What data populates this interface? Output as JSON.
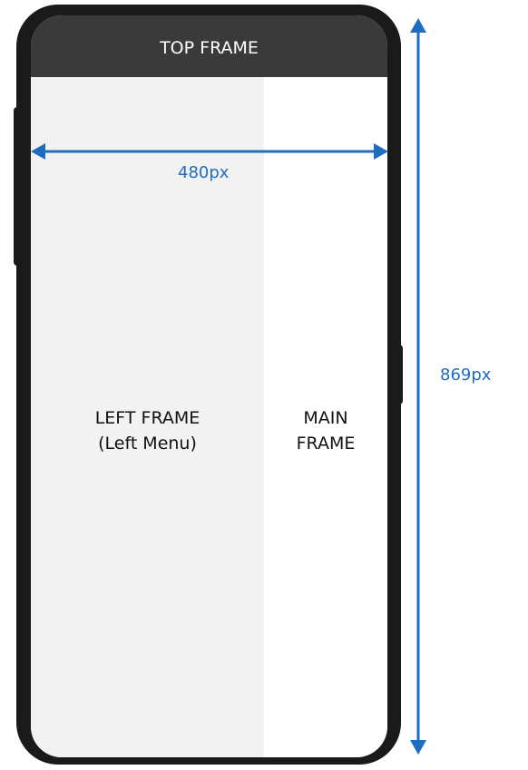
{
  "top_frame": {
    "label": "TOP FRAME"
  },
  "left_frame": {
    "line1": "LEFT FRAME",
    "line2": "(Left Menu)"
  },
  "main_frame": {
    "line1": "MAIN",
    "line2": "FRAME"
  },
  "dimensions": {
    "width_label": "480px",
    "height_label": "869px",
    "color": "#1f6dc0"
  },
  "colors": {
    "phone_body": "#1a1a1a",
    "top_frame_bg": "#3a3a3a",
    "left_frame_bg": "#f2f2f2",
    "main_frame_bg": "#ffffff"
  }
}
